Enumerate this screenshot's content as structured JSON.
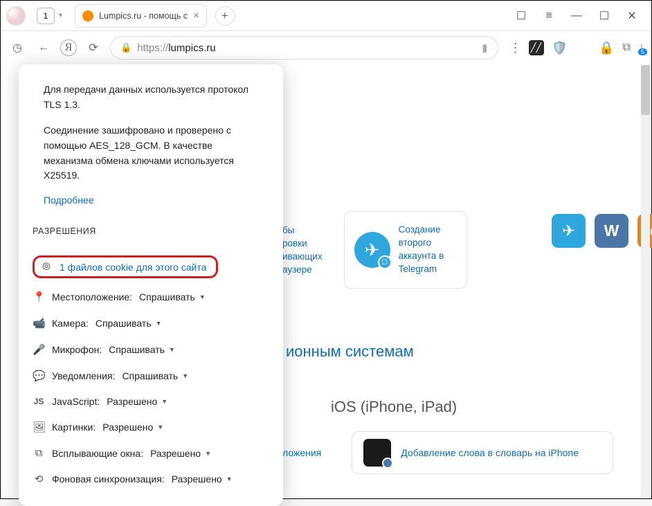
{
  "titlebar": {
    "tab_count": "1",
    "tab_title": "Lumpics.ru - помощь с"
  },
  "addressbar": {
    "scheme": "https://",
    "domain": "lumpics.ru",
    "downloads_badge": "5"
  },
  "dropdown": {
    "tls_text": "Для передачи данных используется протокол TLS 1.3.",
    "cipher_text": "Соединение зашифровано и проверено с помощью AES_128_GCM. В качестве механизма обмена ключами используется X25519.",
    "more_link": "Подробнее",
    "section": "РАЗРЕШЕНИЯ",
    "cookie_link": "1 файлов cookie для этого сайта",
    "perms": {
      "location_label": "Местоположение:",
      "location_value": "Спрашивать",
      "camera_label": "Камера:",
      "camera_value": "Спрашивать",
      "mic_label": "Микрофон:",
      "mic_value": "Спрашивать",
      "notif_label": "Уведомления:",
      "notif_value": "Спрашивать",
      "js_label": "JavaScript:",
      "js_value": "Разрешено",
      "img_label": "Картинки:",
      "img_value": "Разрешено",
      "popup_label": "Всплывающие окна:",
      "popup_value": "Разрешено",
      "sync_label": "Фоновая синхронизация:",
      "sync_value": "Разрешено"
    }
  },
  "page": {
    "card1_partial": [
      "бы",
      "ровки",
      "ивающих",
      "аузере"
    ],
    "card2_lines": [
      "Создание",
      "второго",
      "аккаунта в",
      "Telegram"
    ],
    "section_head": "ионным системам",
    "ios_head": "iOS (iPhone, iPad)",
    "ios_partial": "ложения",
    "ios_link": "Добавление слова в словарь на iPhone"
  }
}
